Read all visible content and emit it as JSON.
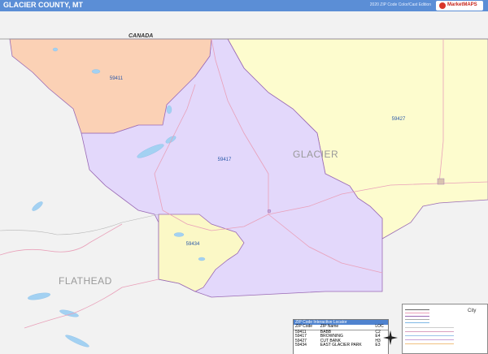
{
  "header": {
    "title": "GLACIER COUNTY, MT",
    "edition": "2020 ZIP Code Color/Cast Edition",
    "logo_text": "MarketMAPS"
  },
  "map": {
    "labels": {
      "canada": "CANADA",
      "glacier": "GLACIER",
      "flathead": "FLATHEAD"
    },
    "zip_labels": {
      "z59411": "59411",
      "z59417": "59417",
      "z59427": "59427",
      "z59434": "59434"
    },
    "colors": {
      "z59411": "#fbd1b5",
      "z59417": "#e3d8fb",
      "z59427": "#fdfcce",
      "z59434": "#fbf8c6",
      "outside": "#f2f2f2",
      "water": "#a3d1f2",
      "road": "#e9a0b9",
      "boundary": "#9a6ab5",
      "header": "#5b8ed6"
    }
  },
  "zip_table": {
    "caption": "ZIP Code Interactive Locator",
    "headers": [
      "ZIP Code",
      "ZIP Name",
      "LOC"
    ],
    "rows": [
      [
        "59411",
        "BABB",
        "C2"
      ],
      [
        "59417",
        "BROWNING",
        "E4"
      ],
      [
        "59427",
        "CUT BANK",
        "H3"
      ],
      [
        "59434",
        "EAST GLACIER PARK",
        "E3"
      ]
    ]
  },
  "legend": {
    "city_label": "City"
  }
}
